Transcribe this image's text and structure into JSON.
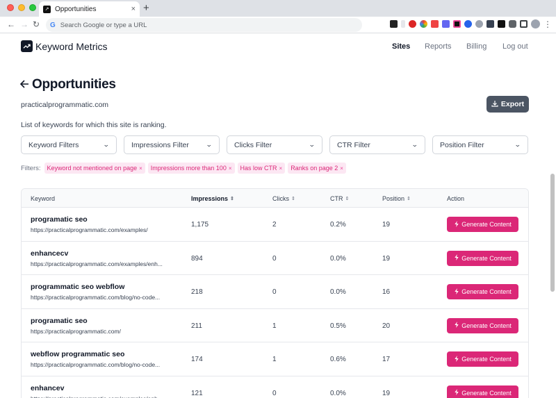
{
  "browser": {
    "tab_title": "Opportunities",
    "tab_close": "×",
    "new_tab": "+",
    "omnibox_placeholder": "Search Google or type a URL",
    "colors": {
      "tabbar": "#dee1e6",
      "omnibox": "#f1f3f4"
    },
    "extensions": [
      "pen-ext-icon",
      "red-shield-ext-icon",
      "chrome-ext-icon",
      "bookmark-ext-icon",
      "d-ext-icon",
      "square-ext-icon",
      "globe-ext-icon",
      "grammarly-ext-icon",
      "keyboard-ext-icon",
      "arrow-ext-icon",
      "puzzle-ext-icon",
      "sidebar-icon",
      "avatar-icon",
      "kebab-menu-icon"
    ]
  },
  "header": {
    "brand": "Keyword Metrics",
    "nav": [
      "Sites",
      "Reports",
      "Billing",
      "Log out"
    ],
    "active_nav": "Sites"
  },
  "page": {
    "title": "Opportunities",
    "site": "practicalprogrammatic.com",
    "export_label": "Export",
    "subtitle": "List of keywords for which this site is ranking."
  },
  "filters": {
    "selects": [
      "Keyword Filters",
      "Impressions Filter",
      "Clicks Filter",
      "CTR Filter",
      "Position Filter"
    ],
    "label": "Filters:",
    "chips": [
      "Keyword not mentioned on page",
      "Impressions more than 100",
      "Has low CTR",
      "Ranks on page 2"
    ],
    "chip_remove": "×"
  },
  "table": {
    "headers": [
      "Keyword",
      "Impressions",
      "Clicks",
      "CTR",
      "Position",
      "Action"
    ],
    "action_label": "Generate Content",
    "rows": [
      {
        "keyword": "programatic seo",
        "url": "https://practicalprogrammatic.com/examples/",
        "impressions": "1,175",
        "clicks": "2",
        "ctr": "0.2%",
        "position": "19"
      },
      {
        "keyword": "enhancecv",
        "url": "https://practicalprogrammatic.com/examples/enh...",
        "impressions": "894",
        "clicks": "0",
        "ctr": "0.0%",
        "position": "19"
      },
      {
        "keyword": "programmatic seo webflow",
        "url": "https://practicalprogrammatic.com/blog/no-code...",
        "impressions": "218",
        "clicks": "0",
        "ctr": "0.0%",
        "position": "16"
      },
      {
        "keyword": "programatic seo",
        "url": "https://practicalprogrammatic.com/",
        "impressions": "211",
        "clicks": "1",
        "ctr": "0.5%",
        "position": "20"
      },
      {
        "keyword": "webflow programmatic seo",
        "url": "https://practicalprogrammatic.com/blog/no-code...",
        "impressions": "174",
        "clicks": "1",
        "ctr": "0.6%",
        "position": "17"
      },
      {
        "keyword": "enhancev",
        "url": "https://practicalprogrammatic.com/examples/enh...",
        "impressions": "121",
        "clicks": "0",
        "ctr": "0.0%",
        "position": "19"
      }
    ]
  },
  "colors": {
    "accent": "#db2777",
    "chip_bg": "#fce7f3",
    "export_bg": "#4b5563"
  }
}
